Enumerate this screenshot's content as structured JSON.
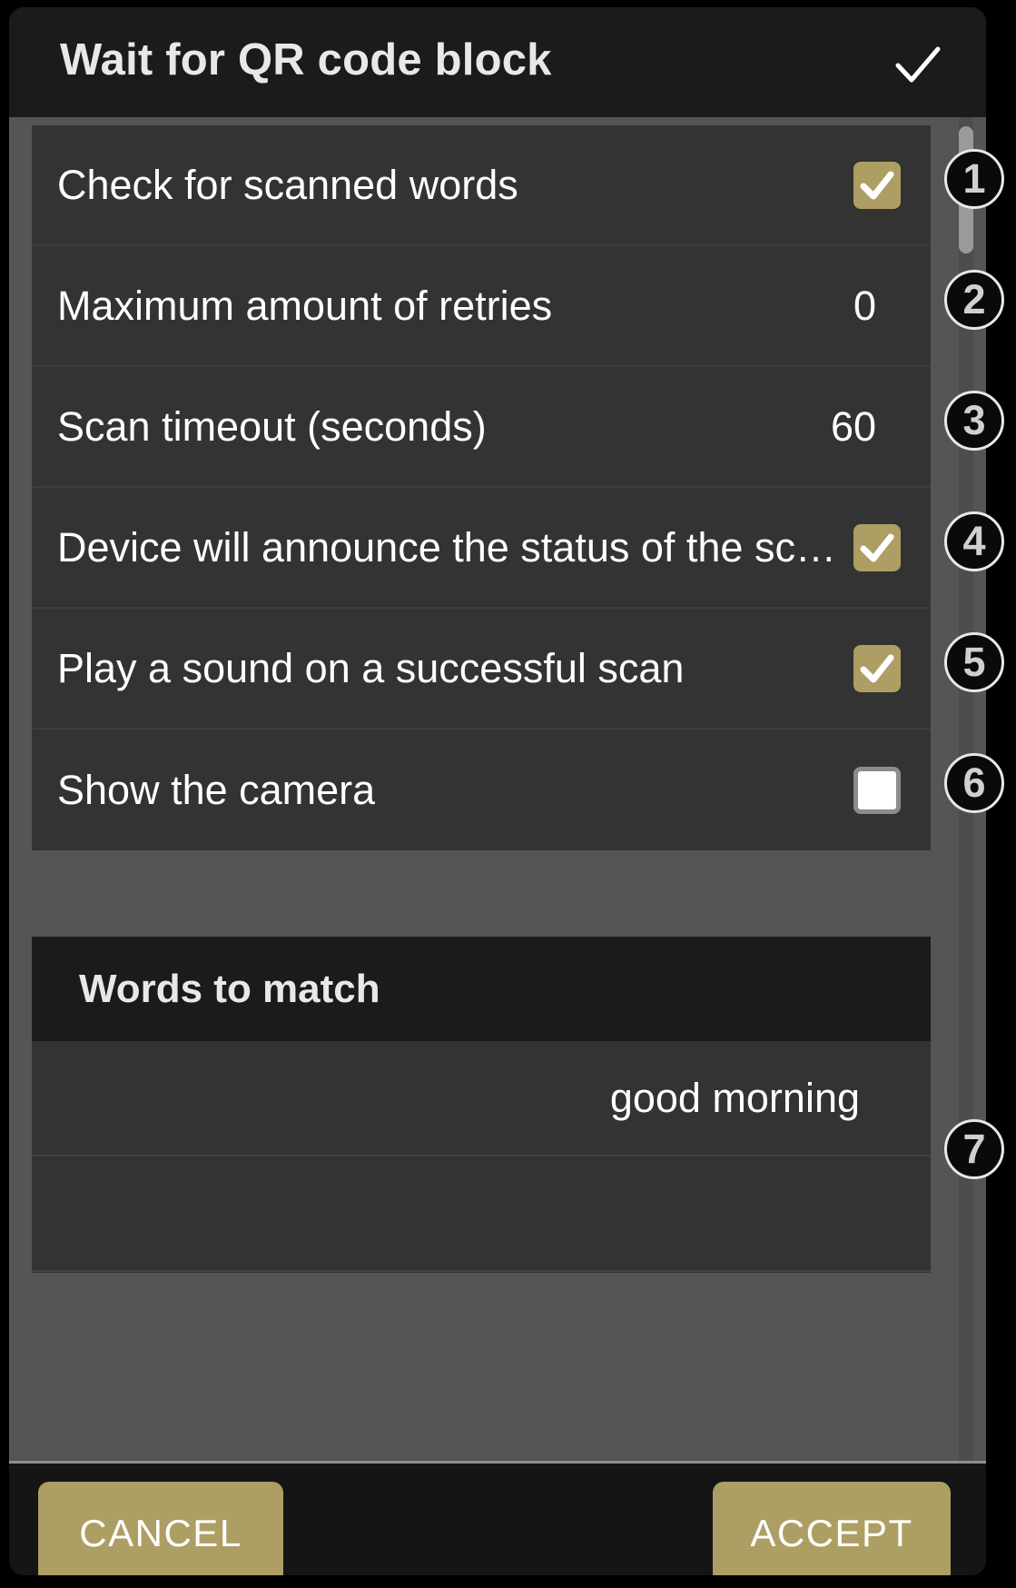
{
  "dialog": {
    "title": "Wait for QR code block",
    "confirm_icon": "check-icon"
  },
  "settings": {
    "rows": [
      {
        "label": "Check for scanned words",
        "type": "checkbox",
        "checked": true,
        "badge": "1"
      },
      {
        "label": "Maximum amount of retries",
        "type": "value",
        "value": "0",
        "badge": "2"
      },
      {
        "label": "Scan timeout (seconds)",
        "type": "value",
        "value": "60",
        "badge": "3"
      },
      {
        "label": "Device will announce the status of the sc…",
        "type": "checkbox",
        "checked": true,
        "badge": "4"
      },
      {
        "label": "Play a sound on a successful scan",
        "type": "checkbox",
        "checked": true,
        "badge": "5"
      },
      {
        "label": "Show the camera",
        "type": "checkbox",
        "checked": false,
        "badge": "6"
      }
    ]
  },
  "words_section": {
    "header": "Words to match",
    "items": [
      {
        "text": "good morning",
        "badge": "7"
      },
      {
        "text": ""
      }
    ]
  },
  "footer": {
    "cancel_label": "CANCEL",
    "accept_label": "ACCEPT"
  },
  "colors": {
    "accent": "#ad9e63",
    "dialog_bg": "#151515",
    "row_bg": "#333333",
    "body_bg": "#555555",
    "text": "#ffffff"
  }
}
